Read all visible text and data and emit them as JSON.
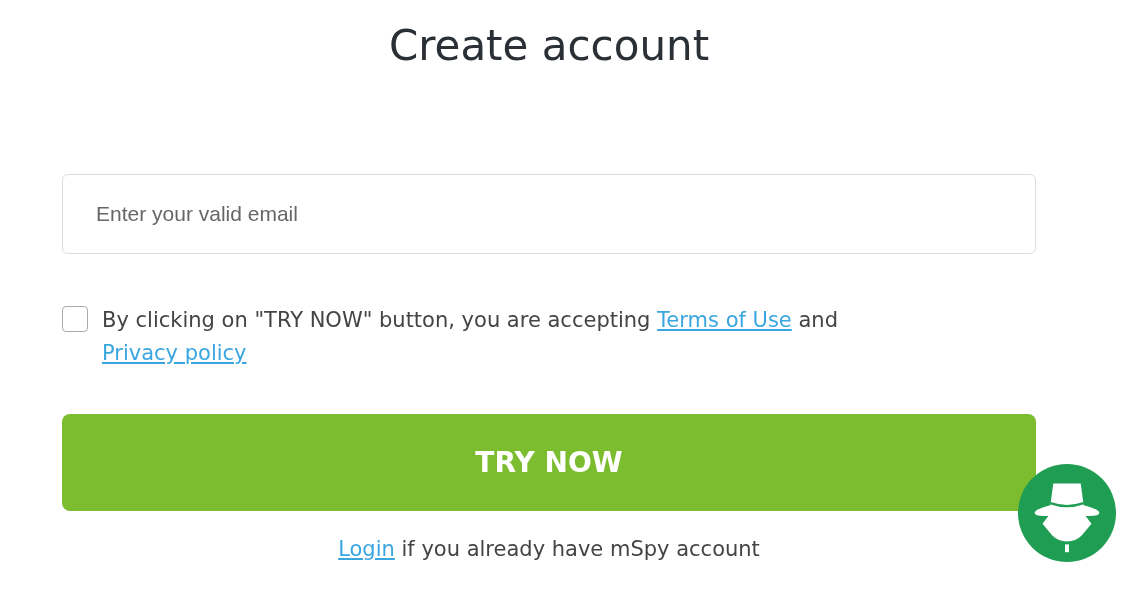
{
  "title": "Create account",
  "email_field": {
    "placeholder": "Enter your valid email"
  },
  "agreement": {
    "checked": false,
    "segments": [
      {
        "kind": "text",
        "text": "By clicking on \"TRY NOW\" button, you are accepting "
      },
      {
        "kind": "link",
        "text": "Terms of Use"
      },
      {
        "kind": "text",
        "text": " and "
      },
      {
        "kind": "link",
        "text": "Privacy policy"
      }
    ]
  },
  "submit_button": {
    "label": "TRY NOW"
  },
  "login_line": {
    "segments": [
      {
        "kind": "link",
        "text": "Login"
      },
      {
        "kind": "text",
        "text": " if you already have mSpy account"
      }
    ]
  },
  "chat_widget": {
    "kind": "mascot"
  }
}
